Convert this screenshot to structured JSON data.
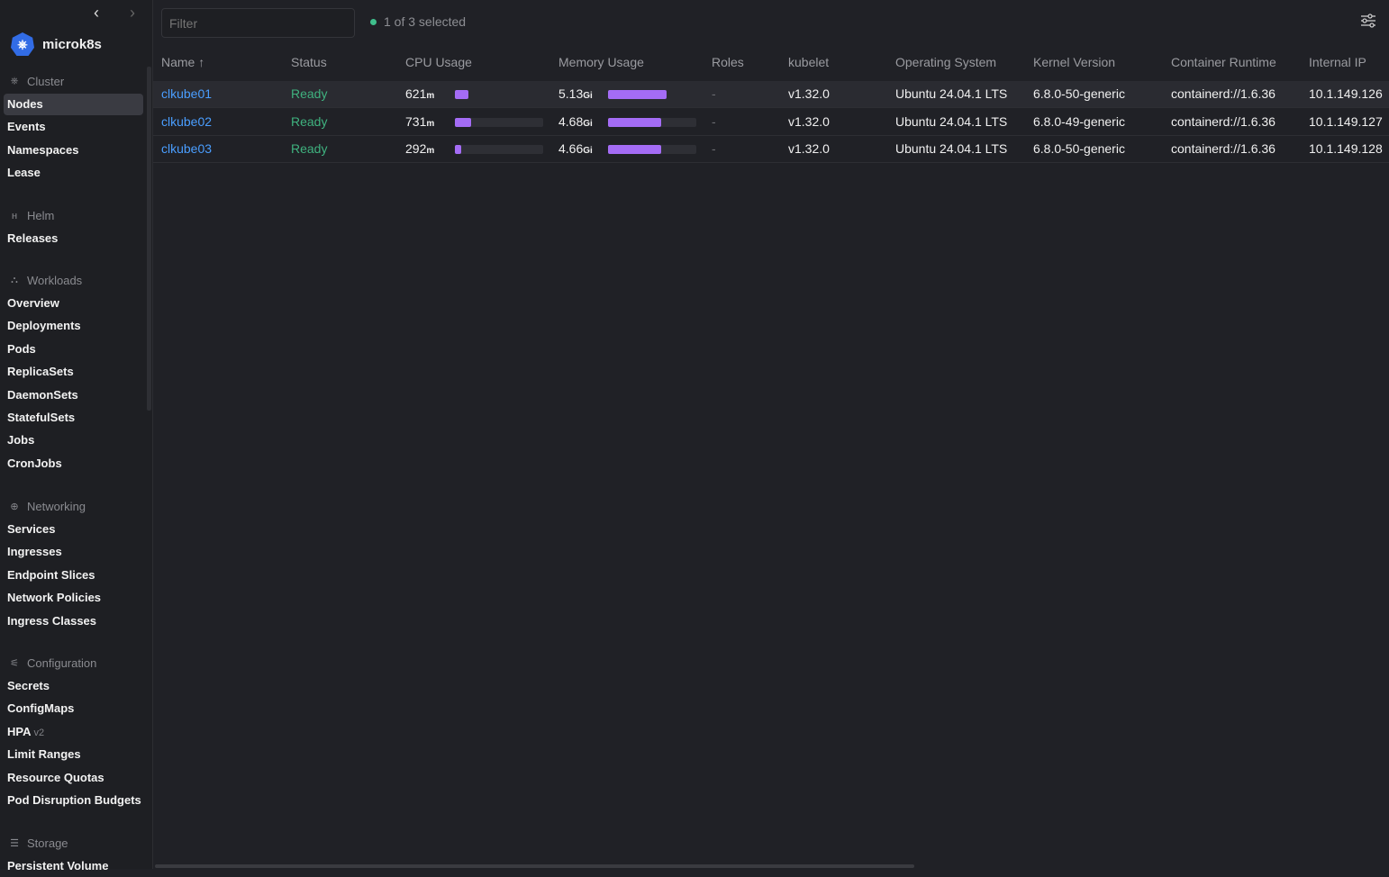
{
  "app": {
    "cluster_name": "microk8s"
  },
  "sidebar": {
    "sections": [
      {
        "title": "Cluster",
        "icon": "kubernetes-icon",
        "items": [
          {
            "label": "Nodes",
            "active": true
          },
          {
            "label": "Events"
          },
          {
            "label": "Namespaces"
          },
          {
            "label": "Lease"
          }
        ]
      },
      {
        "title": "Helm",
        "icon": "helm-icon",
        "items": [
          {
            "label": "Releases"
          }
        ]
      },
      {
        "title": "Workloads",
        "icon": "workloads-icon",
        "items": [
          {
            "label": "Overview"
          },
          {
            "label": "Deployments"
          },
          {
            "label": "Pods"
          },
          {
            "label": "ReplicaSets"
          },
          {
            "label": "DaemonSets"
          },
          {
            "label": "StatefulSets"
          },
          {
            "label": "Jobs"
          },
          {
            "label": "CronJobs"
          }
        ]
      },
      {
        "title": "Networking",
        "icon": "networking-icon",
        "items": [
          {
            "label": "Services"
          },
          {
            "label": "Ingresses"
          },
          {
            "label": "Endpoint Slices"
          },
          {
            "label": "Network Policies"
          },
          {
            "label": "Ingress Classes"
          }
        ]
      },
      {
        "title": "Configuration",
        "icon": "configuration-icon",
        "items": [
          {
            "label": "Secrets"
          },
          {
            "label": "ConfigMaps"
          },
          {
            "label": "HPA",
            "badge": "v2"
          },
          {
            "label": "Limit Ranges"
          },
          {
            "label": "Resource Quotas"
          },
          {
            "label": "Pod Disruption Budgets"
          }
        ]
      },
      {
        "title": "Storage",
        "icon": "storage-icon",
        "items": [
          {
            "label": "Persistent Volume"
          }
        ]
      }
    ]
  },
  "toolbar": {
    "filter_placeholder": "Filter",
    "selection": "1 of 3 selected"
  },
  "table": {
    "headers": [
      "Name ↑",
      "Status",
      "CPU Usage",
      "Memory Usage",
      "Roles",
      "kubelet",
      "Operating System",
      "Kernel Version",
      "Container Runtime",
      "Internal IP"
    ],
    "rows": [
      {
        "name": "clkube01",
        "status": "Ready",
        "cpu": "621",
        "cpu_unit": "m",
        "cpu_pct": 15,
        "mem": "5.13",
        "mem_unit": "Gi",
        "mem_pct": 66,
        "roles": "-",
        "kubelet": "v1.32.0",
        "os": "Ubuntu 24.04.1 LTS",
        "kernel": "6.8.0-50-generic",
        "runtime": "containerd://1.6.36",
        "ip": "10.1.149.126",
        "selected": true
      },
      {
        "name": "clkube02",
        "status": "Ready",
        "cpu": "731",
        "cpu_unit": "m",
        "cpu_pct": 18,
        "mem": "4.68",
        "mem_unit": "Gi",
        "mem_pct": 60,
        "roles": "-",
        "kubelet": "v1.32.0",
        "os": "Ubuntu 24.04.1 LTS",
        "kernel": "6.8.0-49-generic",
        "runtime": "containerd://1.6.36",
        "ip": "10.1.149.127"
      },
      {
        "name": "clkube03",
        "status": "Ready",
        "cpu": "292",
        "cpu_unit": "m",
        "cpu_pct": 7,
        "mem": "4.66",
        "mem_unit": "Gi",
        "mem_pct": 60,
        "roles": "-",
        "kubelet": "v1.32.0",
        "os": "Ubuntu 24.04.1 LTS",
        "kernel": "6.8.0-50-generic",
        "runtime": "containerd://1.6.36",
        "ip": "10.1.149.128"
      }
    ]
  }
}
